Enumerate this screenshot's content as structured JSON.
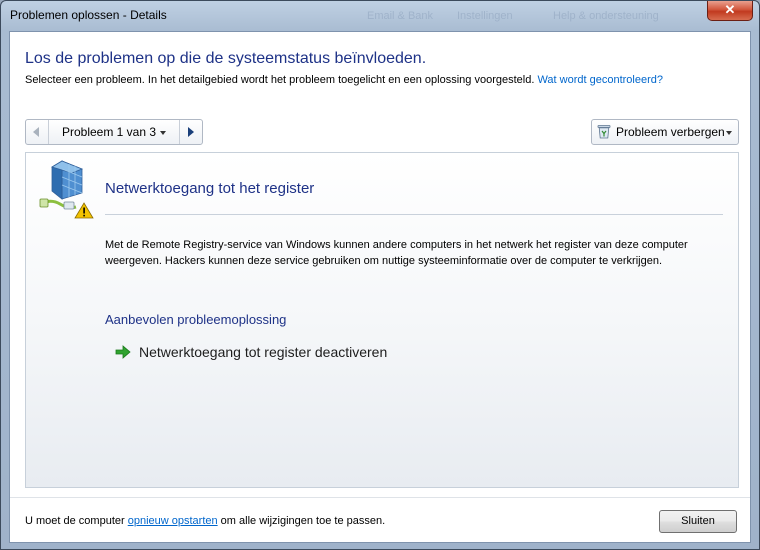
{
  "window": {
    "title": "Problemen oplossen - Details",
    "background_titles": [
      "Email & Bank",
      "Instellingen",
      "Help & ondersteuning"
    ],
    "close_glyph": "✕"
  },
  "header": {
    "heading": "Los de problemen op die de systeemstatus beïnvloeden.",
    "subtitle": "Selecteer een probleem. In het detailgebied wordt het probleem toegelicht en een oplossing voorgesteld.",
    "checked_link": "Wat wordt gecontroleerd?"
  },
  "navigator": {
    "label": "Probleem 1 van 3",
    "current": 1,
    "total": 3
  },
  "hide_button": {
    "label": "Probleem verbergen",
    "icon": "recycle-bin-icon"
  },
  "problem": {
    "icon": "network-registry-warning-icon",
    "title": "Netwerktoegang tot het register",
    "description": "Met de Remote Registry-service van Windows kunnen andere computers in het netwerk het register van deze computer weergeven. Hackers kunnen deze service gebruiken om nuttige systeeminformatie over de computer te verkrijgen.",
    "recommendation_heading": "Aanbevolen probleemoplossing",
    "fix_label": "Netwerktoegang tot register deactiveren",
    "fix_icon": "green-arrow-icon"
  },
  "footer": {
    "text_before": "U moet de computer ",
    "restart_link": "opnieuw opstarten",
    "text_after": " om alle wijzigingen toe te passen.",
    "close_label": "Sluiten"
  },
  "colors": {
    "heading": "#1e3287",
    "link": "#0066cc",
    "fix_arrow": "#2fa32f",
    "warning": "#f2c200"
  }
}
